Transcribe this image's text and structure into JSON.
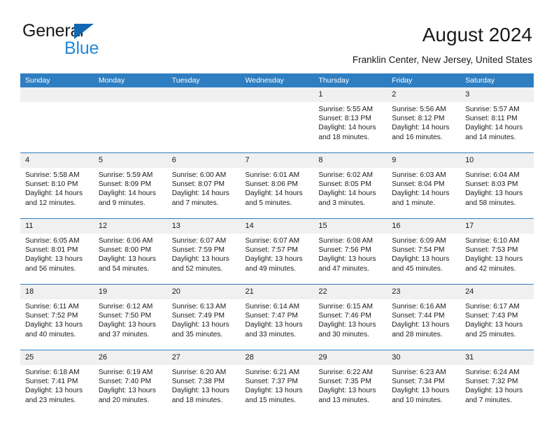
{
  "brand": {
    "line1": "General",
    "line2": "Blue",
    "triangle_color": "#1268b3",
    "blue_text_color": "#2389d8"
  },
  "header": {
    "title": "August 2024",
    "subtitle": "Franklin Center, New Jersey, United States"
  },
  "theme": {
    "header_blue": "#2e7ec1",
    "daynum_band": "#f0f0f0",
    "text": "#1a1a1a",
    "background": "#ffffff"
  },
  "calendar": {
    "weekdays": [
      "Sunday",
      "Monday",
      "Tuesday",
      "Wednesday",
      "Thursday",
      "Friday",
      "Saturday"
    ],
    "weeks": [
      [
        {
          "day": "",
          "sunrise": "",
          "sunset": "",
          "daylight_line1": "",
          "daylight_line2": ""
        },
        {
          "day": "",
          "sunrise": "",
          "sunset": "",
          "daylight_line1": "",
          "daylight_line2": ""
        },
        {
          "day": "",
          "sunrise": "",
          "sunset": "",
          "daylight_line1": "",
          "daylight_line2": ""
        },
        {
          "day": "",
          "sunrise": "",
          "sunset": "",
          "daylight_line1": "",
          "daylight_line2": ""
        },
        {
          "day": "1",
          "sunrise": "Sunrise: 5:55 AM",
          "sunset": "Sunset: 8:13 PM",
          "daylight_line1": "Daylight: 14 hours",
          "daylight_line2": "and 18 minutes."
        },
        {
          "day": "2",
          "sunrise": "Sunrise: 5:56 AM",
          "sunset": "Sunset: 8:12 PM",
          "daylight_line1": "Daylight: 14 hours",
          "daylight_line2": "and 16 minutes."
        },
        {
          "day": "3",
          "sunrise": "Sunrise: 5:57 AM",
          "sunset": "Sunset: 8:11 PM",
          "daylight_line1": "Daylight: 14 hours",
          "daylight_line2": "and 14 minutes."
        }
      ],
      [
        {
          "day": "4",
          "sunrise": "Sunrise: 5:58 AM",
          "sunset": "Sunset: 8:10 PM",
          "daylight_line1": "Daylight: 14 hours",
          "daylight_line2": "and 12 minutes."
        },
        {
          "day": "5",
          "sunrise": "Sunrise: 5:59 AM",
          "sunset": "Sunset: 8:09 PM",
          "daylight_line1": "Daylight: 14 hours",
          "daylight_line2": "and 9 minutes."
        },
        {
          "day": "6",
          "sunrise": "Sunrise: 6:00 AM",
          "sunset": "Sunset: 8:07 PM",
          "daylight_line1": "Daylight: 14 hours",
          "daylight_line2": "and 7 minutes."
        },
        {
          "day": "7",
          "sunrise": "Sunrise: 6:01 AM",
          "sunset": "Sunset: 8:06 PM",
          "daylight_line1": "Daylight: 14 hours",
          "daylight_line2": "and 5 minutes."
        },
        {
          "day": "8",
          "sunrise": "Sunrise: 6:02 AM",
          "sunset": "Sunset: 8:05 PM",
          "daylight_line1": "Daylight: 14 hours",
          "daylight_line2": "and 3 minutes."
        },
        {
          "day": "9",
          "sunrise": "Sunrise: 6:03 AM",
          "sunset": "Sunset: 8:04 PM",
          "daylight_line1": "Daylight: 14 hours",
          "daylight_line2": "and 1 minute."
        },
        {
          "day": "10",
          "sunrise": "Sunrise: 6:04 AM",
          "sunset": "Sunset: 8:03 PM",
          "daylight_line1": "Daylight: 13 hours",
          "daylight_line2": "and 58 minutes."
        }
      ],
      [
        {
          "day": "11",
          "sunrise": "Sunrise: 6:05 AM",
          "sunset": "Sunset: 8:01 PM",
          "daylight_line1": "Daylight: 13 hours",
          "daylight_line2": "and 56 minutes."
        },
        {
          "day": "12",
          "sunrise": "Sunrise: 6:06 AM",
          "sunset": "Sunset: 8:00 PM",
          "daylight_line1": "Daylight: 13 hours",
          "daylight_line2": "and 54 minutes."
        },
        {
          "day": "13",
          "sunrise": "Sunrise: 6:07 AM",
          "sunset": "Sunset: 7:59 PM",
          "daylight_line1": "Daylight: 13 hours",
          "daylight_line2": "and 52 minutes."
        },
        {
          "day": "14",
          "sunrise": "Sunrise: 6:07 AM",
          "sunset": "Sunset: 7:57 PM",
          "daylight_line1": "Daylight: 13 hours",
          "daylight_line2": "and 49 minutes."
        },
        {
          "day": "15",
          "sunrise": "Sunrise: 6:08 AM",
          "sunset": "Sunset: 7:56 PM",
          "daylight_line1": "Daylight: 13 hours",
          "daylight_line2": "and 47 minutes."
        },
        {
          "day": "16",
          "sunrise": "Sunrise: 6:09 AM",
          "sunset": "Sunset: 7:54 PM",
          "daylight_line1": "Daylight: 13 hours",
          "daylight_line2": "and 45 minutes."
        },
        {
          "day": "17",
          "sunrise": "Sunrise: 6:10 AM",
          "sunset": "Sunset: 7:53 PM",
          "daylight_line1": "Daylight: 13 hours",
          "daylight_line2": "and 42 minutes."
        }
      ],
      [
        {
          "day": "18",
          "sunrise": "Sunrise: 6:11 AM",
          "sunset": "Sunset: 7:52 PM",
          "daylight_line1": "Daylight: 13 hours",
          "daylight_line2": "and 40 minutes."
        },
        {
          "day": "19",
          "sunrise": "Sunrise: 6:12 AM",
          "sunset": "Sunset: 7:50 PM",
          "daylight_line1": "Daylight: 13 hours",
          "daylight_line2": "and 37 minutes."
        },
        {
          "day": "20",
          "sunrise": "Sunrise: 6:13 AM",
          "sunset": "Sunset: 7:49 PM",
          "daylight_line1": "Daylight: 13 hours",
          "daylight_line2": "and 35 minutes."
        },
        {
          "day": "21",
          "sunrise": "Sunrise: 6:14 AM",
          "sunset": "Sunset: 7:47 PM",
          "daylight_line1": "Daylight: 13 hours",
          "daylight_line2": "and 33 minutes."
        },
        {
          "day": "22",
          "sunrise": "Sunrise: 6:15 AM",
          "sunset": "Sunset: 7:46 PM",
          "daylight_line1": "Daylight: 13 hours",
          "daylight_line2": "and 30 minutes."
        },
        {
          "day": "23",
          "sunrise": "Sunrise: 6:16 AM",
          "sunset": "Sunset: 7:44 PM",
          "daylight_line1": "Daylight: 13 hours",
          "daylight_line2": "and 28 minutes."
        },
        {
          "day": "24",
          "sunrise": "Sunrise: 6:17 AM",
          "sunset": "Sunset: 7:43 PM",
          "daylight_line1": "Daylight: 13 hours",
          "daylight_line2": "and 25 minutes."
        }
      ],
      [
        {
          "day": "25",
          "sunrise": "Sunrise: 6:18 AM",
          "sunset": "Sunset: 7:41 PM",
          "daylight_line1": "Daylight: 13 hours",
          "daylight_line2": "and 23 minutes."
        },
        {
          "day": "26",
          "sunrise": "Sunrise: 6:19 AM",
          "sunset": "Sunset: 7:40 PM",
          "daylight_line1": "Daylight: 13 hours",
          "daylight_line2": "and 20 minutes."
        },
        {
          "day": "27",
          "sunrise": "Sunrise: 6:20 AM",
          "sunset": "Sunset: 7:38 PM",
          "daylight_line1": "Daylight: 13 hours",
          "daylight_line2": "and 18 minutes."
        },
        {
          "day": "28",
          "sunrise": "Sunrise: 6:21 AM",
          "sunset": "Sunset: 7:37 PM",
          "daylight_line1": "Daylight: 13 hours",
          "daylight_line2": "and 15 minutes."
        },
        {
          "day": "29",
          "sunrise": "Sunrise: 6:22 AM",
          "sunset": "Sunset: 7:35 PM",
          "daylight_line1": "Daylight: 13 hours",
          "daylight_line2": "and 13 minutes."
        },
        {
          "day": "30",
          "sunrise": "Sunrise: 6:23 AM",
          "sunset": "Sunset: 7:34 PM",
          "daylight_line1": "Daylight: 13 hours",
          "daylight_line2": "and 10 minutes."
        },
        {
          "day": "31",
          "sunrise": "Sunrise: 6:24 AM",
          "sunset": "Sunset: 7:32 PM",
          "daylight_line1": "Daylight: 13 hours",
          "daylight_line2": "and 7 minutes."
        }
      ]
    ]
  }
}
